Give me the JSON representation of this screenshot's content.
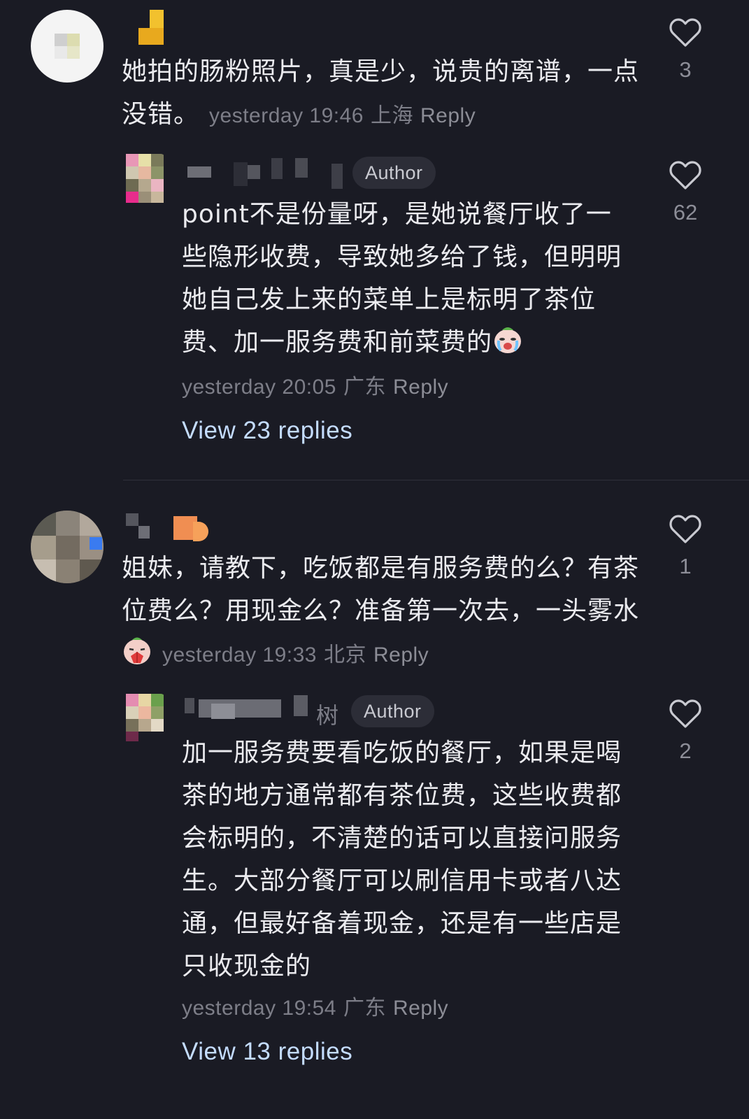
{
  "comments": [
    {
      "text": "她拍的肠粉照片，真是少，说贵的离谱，一点没错。",
      "time": "yesterday 19:46",
      "location": "上海",
      "reply_label": "Reply",
      "likes": "3",
      "replies": [
        {
          "author_badge": "Author",
          "text": "point不是份量呀，是她说餐厅收了一些隐形收费，导致她多给了钱，但明明她自己发上来的菜单上是标明了茶位费、加一服务费和前菜费的",
          "emoji": "crying-face-emoji",
          "time": "yesterday 20:05",
          "location": "广东",
          "reply_label": "Reply",
          "likes": "62",
          "view_replies": "View 23 replies"
        }
      ]
    },
    {
      "text": "姐妹，请教下，吃饭都是有服务费的么？有茶位费么？用现金么？准备第一次去，一头雾水",
      "emoji": "pleading-hands-emoji",
      "time": "yesterday 19:33",
      "location": "北京",
      "reply_label": "Reply",
      "likes": "1",
      "replies": [
        {
          "author_suffix": "树",
          "author_badge": "Author",
          "text": "加一服务费要看吃饭的餐厅，如果是喝茶的地方通常都有茶位费，这些收费都会标明的，不清楚的话可以直接问服务生。大部分餐厅可以刷信用卡或者八达通，但最好备着现金，还是有一些店是只收现金的",
          "time": "yesterday 19:54",
          "location": "广东",
          "reply_label": "Reply",
          "likes": "2",
          "view_replies": "View 13 replies"
        }
      ]
    }
  ],
  "colors": {
    "background": "#1a1b24",
    "link": "#c4dcff",
    "meta": "#7d7e88"
  }
}
